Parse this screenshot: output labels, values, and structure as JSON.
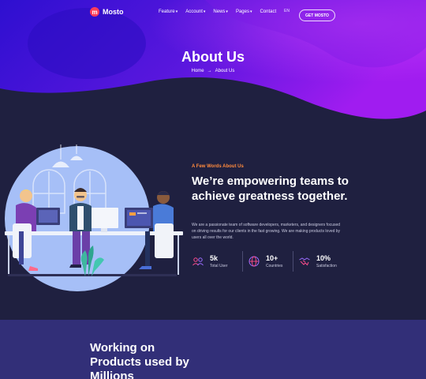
{
  "nav": {
    "logo_text": "Mosto",
    "menu": [
      {
        "label": "Feature",
        "dropdown": true
      },
      {
        "label": "Account",
        "dropdown": true
      },
      {
        "label": "News",
        "dropdown": true
      },
      {
        "label": "Pages",
        "dropdown": true
      },
      {
        "label": "Contact",
        "dropdown": false
      }
    ],
    "lang": "EN",
    "cta_label": "GET MOSTO"
  },
  "hero": {
    "title": "About Us",
    "breadcrumb": {
      "home": "Home",
      "separator": "→",
      "current": "About Us"
    }
  },
  "about": {
    "eyebrow": "A Few Words About Us",
    "headline": "We’re empowering teams to achieve greatness together.",
    "body": "We are a passionate team of software developers, marketers, and designers focused on driving results for our clients in the fast growing. We are making products loved by users all over the world.",
    "stats": [
      {
        "value": "5k",
        "label": "Total User",
        "icon": "users-icon"
      },
      {
        "value": "10+",
        "label": "Countries",
        "icon": "globe-icon"
      },
      {
        "value": "10%",
        "label": "Satisfaction",
        "icon": "handshake-icon"
      }
    ]
  },
  "bottom": {
    "title": "Working on Products used by Millions"
  },
  "colors": {
    "bg": "#1f2040",
    "hero_purple": "#8a1ee8",
    "hero_blue": "#3b16d9",
    "accent_orange": "#ff8a3d",
    "stat_icon_pink": "#ff4d8d",
    "stat_icon_violet": "#9a6cff",
    "bottom_bg": "#322f78"
  }
}
